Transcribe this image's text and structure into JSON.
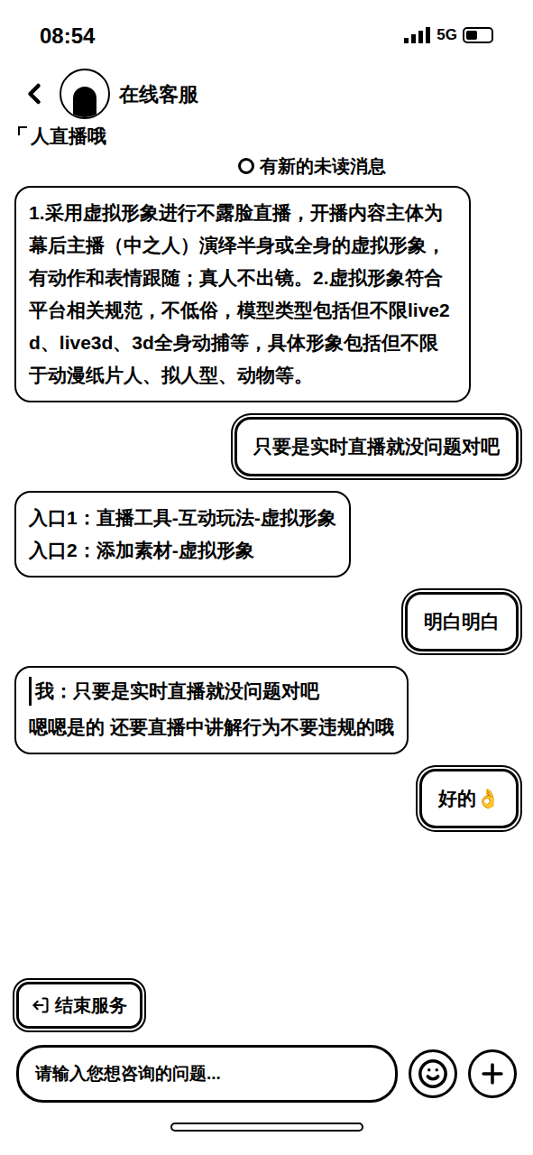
{
  "status_bar": {
    "time": "08:54",
    "network": "5G",
    "battery_level": 0.45
  },
  "header": {
    "title": "在线客服"
  },
  "partial_text": "人直播哦",
  "unread_notice": "有新的未读消息",
  "messages": [
    {
      "side": "left",
      "kind": "text",
      "lines": [
        "1.采用虚拟形象进行不露脸直播，开播内容主体为幕后主播（中之人）演绎半身或全身的虚拟形象，有动作和表情跟随；真人不出镜。2.虚拟形象符合平台相关规范，不低俗，模型类型包括但不限live2d、live3d、3d全身动捕等，具体形象包括但不限于动漫纸片人、拟人型、动物等。"
      ]
    },
    {
      "side": "right",
      "kind": "text",
      "lines": [
        "只要是实时直播就没问题对吧"
      ]
    },
    {
      "side": "left",
      "kind": "text",
      "lines": [
        "入口1：直播工具-互动玩法-虚拟形象",
        "入口2：添加素材-虚拟形象"
      ]
    },
    {
      "side": "right",
      "kind": "text",
      "lines": [
        "明白明白"
      ]
    },
    {
      "side": "left",
      "kind": "quote",
      "quote": "我：只要是实时直播就没问题对吧",
      "lines": [
        "嗯嗯是的 还要直播中讲解行为不要违规的哦"
      ]
    },
    {
      "side": "right",
      "kind": "text",
      "lines": [
        "好的👌"
      ]
    }
  ],
  "end_button": "结束服务",
  "input": {
    "placeholder": "请输入您想咨询的问题..."
  }
}
